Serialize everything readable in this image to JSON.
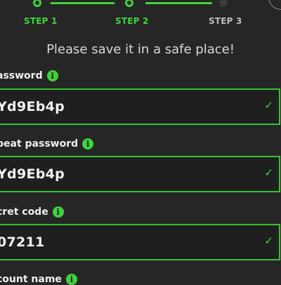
{
  "stepper": {
    "steps": [
      {
        "label": "STEP 1",
        "state": "done"
      },
      {
        "label": "STEP 2",
        "state": "done"
      },
      {
        "label": "STEP 3",
        "state": "todo"
      }
    ]
  },
  "notice": "Please save it in a safe place!",
  "fields": {
    "password": {
      "label": "assword",
      "value": "Yd9Eb4p",
      "info_icon": "info-icon",
      "status_icon": "check-icon"
    },
    "repeat_password": {
      "label": "peat password",
      "value": "Yd9Eb4p",
      "info_icon": "info-icon",
      "status_icon": "check-icon"
    },
    "secret_code": {
      "label": "cret code",
      "value": "07211",
      "info_icon": "info-icon",
      "status_icon": "check-icon"
    },
    "account_name": {
      "label": "count name",
      "info_icon": "info-icon"
    }
  },
  "icons": {
    "info_glyph": "i",
    "check_glyph": "✓"
  },
  "colors": {
    "accent": "#3fd43b",
    "background": "#262626",
    "field_background": "#1f1f1f"
  }
}
